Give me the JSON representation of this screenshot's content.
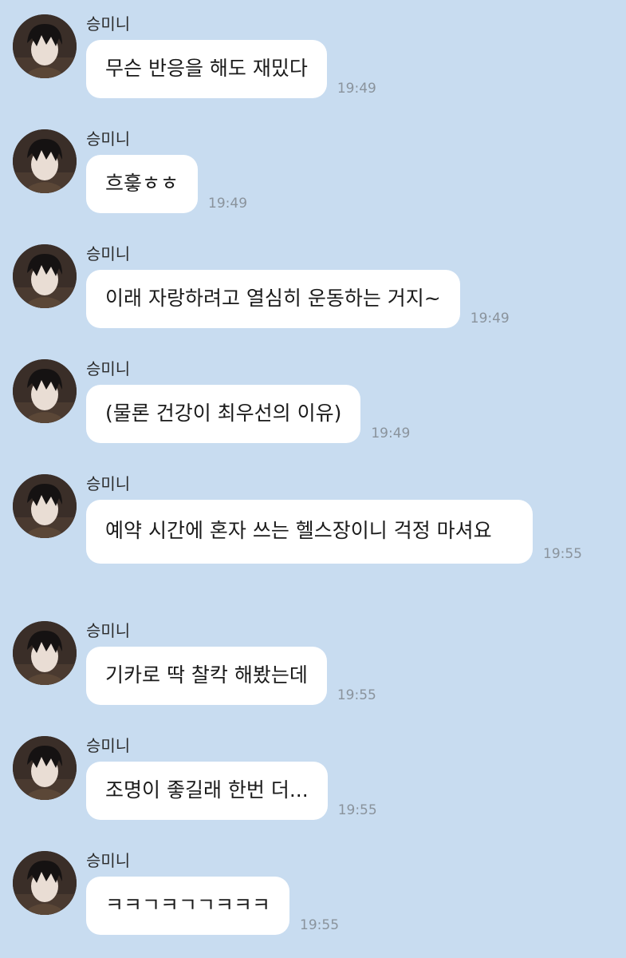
{
  "chat": {
    "messages": [
      {
        "sender": "승미니",
        "text": "무슨 반응을 해도 재밌다",
        "time": "19:49"
      },
      {
        "sender": "승미니",
        "text": "흐흫ㅎㅎ",
        "time": "19:49"
      },
      {
        "sender": "승미니",
        "text": "이래 자랑하려고 열심히 운동하는 거지~",
        "time": "19:49"
      },
      {
        "sender": "승미니",
        "text": "(물론 건강이 최우선의 이유)",
        "time": "19:49"
      },
      {
        "sender": "승미니",
        "text": "예약 시간에 혼자 쓰는 헬스장이니 걱정 마셔요",
        "time": "19:55"
      },
      {
        "sender": "승미니",
        "text": "기카로 딱 찰칵 해봤는데",
        "time": "19:55"
      },
      {
        "sender": "승미니",
        "text": "조명이 좋길래 한번 더...",
        "time": "19:55"
      },
      {
        "sender": "승미니",
        "text": "ㅋㅋㄱㅋㄱㄱㅋㅋㅋ",
        "time": "19:55"
      }
    ]
  },
  "colors": {
    "background": "#c8dcf0",
    "bubble": "#ffffff",
    "time": "#8a939c"
  },
  "icons": {
    "avatar": "profile-photo"
  }
}
